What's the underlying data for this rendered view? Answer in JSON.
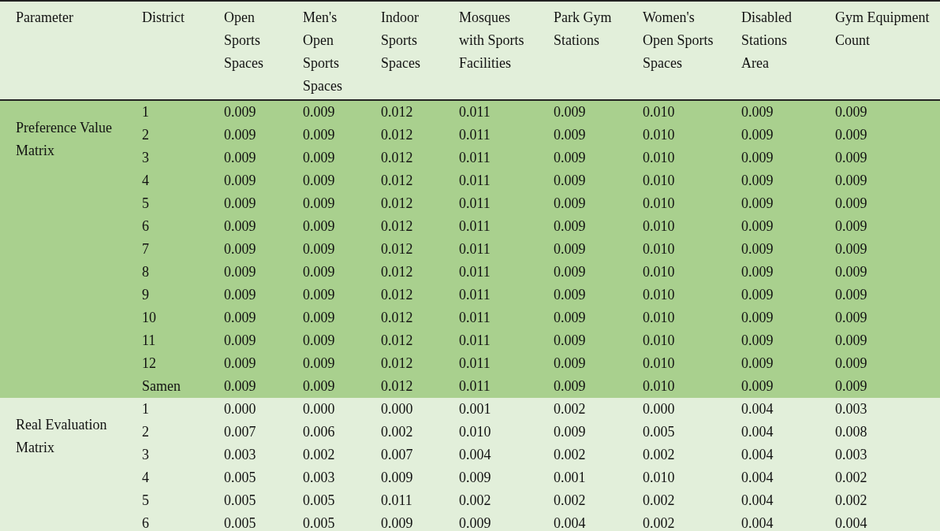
{
  "table": {
    "columns": [
      "Parameter",
      "District",
      "Open Sports Spaces",
      "Men's Open Sports Spaces",
      "Indoor Sports Spaces",
      "Mosques with Sports Facilities",
      "Park Gym Stations",
      "Women's Open Sports Spaces",
      "Disabled Stations Area",
      "Gym Equipment Count"
    ],
    "groups": [
      {
        "label": "Preference Value Matrix",
        "color": "#a9d08e",
        "rows": [
          {
            "district": "1",
            "values": [
              "0.009",
              "0.009",
              "0.012",
              "0.011",
              "0.009",
              "0.010",
              "0.009",
              "0.009"
            ]
          },
          {
            "district": "2",
            "values": [
              "0.009",
              "0.009",
              "0.012",
              "0.011",
              "0.009",
              "0.010",
              "0.009",
              "0.009"
            ]
          },
          {
            "district": "3",
            "values": [
              "0.009",
              "0.009",
              "0.012",
              "0.011",
              "0.009",
              "0.010",
              "0.009",
              "0.009"
            ]
          },
          {
            "district": "4",
            "values": [
              "0.009",
              "0.009",
              "0.012",
              "0.011",
              "0.009",
              "0.010",
              "0.009",
              "0.009"
            ]
          },
          {
            "district": "5",
            "values": [
              "0.009",
              "0.009",
              "0.012",
              "0.011",
              "0.009",
              "0.010",
              "0.009",
              "0.009"
            ]
          },
          {
            "district": "6",
            "values": [
              "0.009",
              "0.009",
              "0.012",
              "0.011",
              "0.009",
              "0.010",
              "0.009",
              "0.009"
            ]
          },
          {
            "district": "7",
            "values": [
              "0.009",
              "0.009",
              "0.012",
              "0.011",
              "0.009",
              "0.010",
              "0.009",
              "0.009"
            ]
          },
          {
            "district": "8",
            "values": [
              "0.009",
              "0.009",
              "0.012",
              "0.011",
              "0.009",
              "0.010",
              "0.009",
              "0.009"
            ]
          },
          {
            "district": "9",
            "values": [
              "0.009",
              "0.009",
              "0.012",
              "0.011",
              "0.009",
              "0.010",
              "0.009",
              "0.009"
            ]
          },
          {
            "district": "10",
            "values": [
              "0.009",
              "0.009",
              "0.012",
              "0.011",
              "0.009",
              "0.010",
              "0.009",
              "0.009"
            ]
          },
          {
            "district": "11",
            "values": [
              "0.009",
              "0.009",
              "0.012",
              "0.011",
              "0.009",
              "0.010",
              "0.009",
              "0.009"
            ]
          },
          {
            "district": "12",
            "values": [
              "0.009",
              "0.009",
              "0.012",
              "0.011",
              "0.009",
              "0.010",
              "0.009",
              "0.009"
            ]
          },
          {
            "district": "Samen",
            "values": [
              "0.009",
              "0.009",
              "0.012",
              "0.011",
              "0.009",
              "0.010",
              "0.009",
              "0.009"
            ]
          }
        ]
      },
      {
        "label": "Real Evaluation Matrix",
        "color": "#e2efda",
        "rows": [
          {
            "district": "1",
            "values": [
              "0.000",
              "0.000",
              "0.000",
              "0.001",
              "0.002",
              "0.000",
              "0.004",
              "0.003"
            ]
          },
          {
            "district": "2",
            "values": [
              "0.007",
              "0.006",
              "0.002",
              "0.010",
              "0.009",
              "0.005",
              "0.004",
              "0.008"
            ]
          },
          {
            "district": "3",
            "values": [
              "0.003",
              "0.002",
              "0.007",
              "0.004",
              "0.002",
              "0.002",
              "0.004",
              "0.003"
            ]
          },
          {
            "district": "4",
            "values": [
              "0.005",
              "0.003",
              "0.009",
              "0.009",
              "0.001",
              "0.010",
              "0.004",
              "0.002"
            ]
          },
          {
            "district": "5",
            "values": [
              "0.005",
              "0.005",
              "0.011",
              "0.002",
              "0.002",
              "0.002",
              "0.004",
              "0.002"
            ]
          },
          {
            "district": "6",
            "values": [
              "0.005",
              "0.005",
              "0.009",
              "0.009",
              "0.004",
              "0.002",
              "0.004",
              "0.004"
            ]
          }
        ]
      }
    ]
  }
}
